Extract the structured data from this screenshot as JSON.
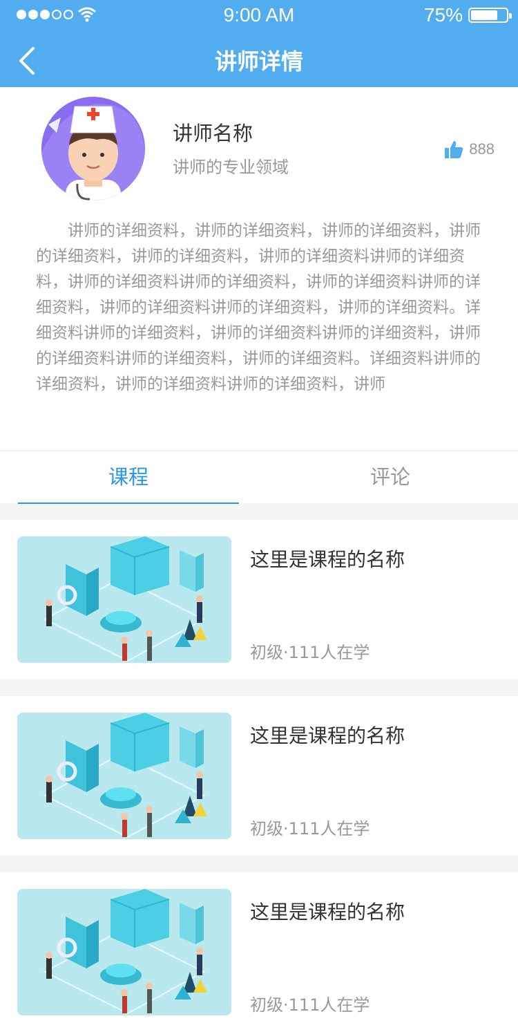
{
  "status_bar": {
    "time": "9:00 AM",
    "battery": "75%",
    "battery_level": 0.75
  },
  "nav": {
    "title": "讲师详情",
    "back_icon": "chevron-left-icon"
  },
  "teacher": {
    "name": "讲师名称",
    "field": "讲师的专业领域",
    "likes": "888",
    "bio": "讲师的详细资料，讲师的详细资料，讲师的详细资料，讲师的详细资料，讲师的详细资料，讲师的详细资料讲师的详细资料，讲师的详细资料讲师的详细资料，讲师的详细资料讲师的详细资料，讲师的详细资料讲师的详细资料，讲师的详细资料。详细资料讲师的详细资料，讲师的详细资料讲师的详细资料，讲师的详细资料讲师的详细资料，讲师的详细资料。详细资料讲师的详细资料，讲师的详细资料讲师的详细资料，讲师"
  },
  "tabs": [
    {
      "label": "课程",
      "active": true
    },
    {
      "label": "评论",
      "active": false
    }
  ],
  "courses": [
    {
      "name": "这里是课程的名称",
      "meta": "初级·111人在学"
    },
    {
      "name": "这里是课程的名称",
      "meta": "初级·111人在学"
    },
    {
      "name": "这里是课程的名称",
      "meta": "初级·111人在学"
    }
  ],
  "colors": {
    "accent": "#52adf0",
    "tab_active": "#2a95e8"
  }
}
